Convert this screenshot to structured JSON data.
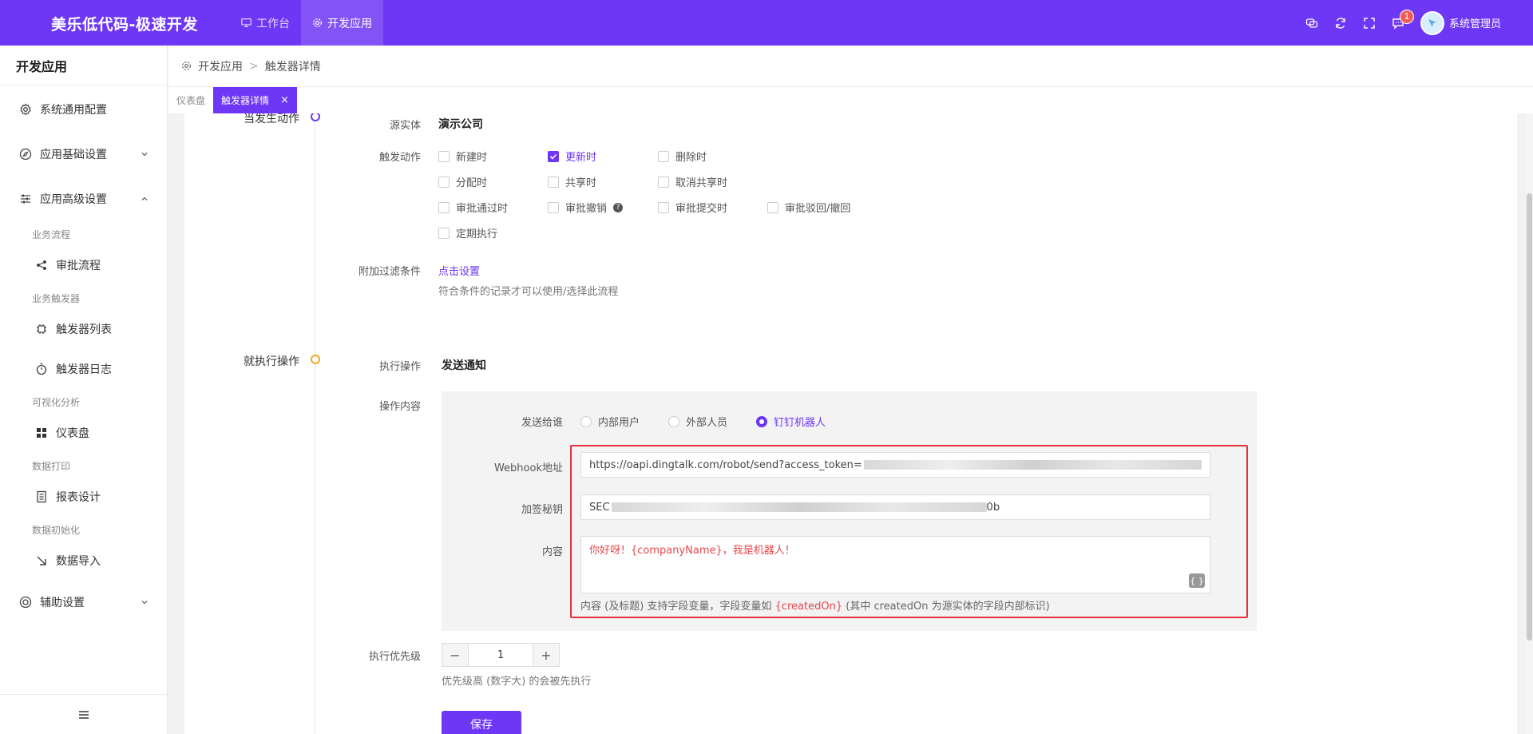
{
  "app": {
    "title": "美乐低代码-极速开发"
  },
  "topnav": {
    "items": [
      {
        "label": "工作台"
      },
      {
        "label": "开发应用"
      }
    ]
  },
  "topright": {
    "notification_count": "1",
    "user_name": "系统管理员"
  },
  "sidebar": {
    "title": "开发应用",
    "items": {
      "system_config": "系统通用配置",
      "app_basic": "应用基础设置",
      "app_advanced": "应用高级设置",
      "group_flow": "业务流程",
      "approval_flow": "审批流程",
      "group_trigger": "业务触发器",
      "trigger_list": "触发器列表",
      "trigger_log": "触发器日志",
      "group_visual": "可视化分析",
      "dashboard": "仪表盘",
      "group_print": "数据打印",
      "report_design": "报表设计",
      "group_init": "数据初始化",
      "data_import": "数据导入",
      "aux_settings": "辅助设置"
    }
  },
  "breadcrumb": {
    "parent": "开发应用",
    "separator": ">",
    "current": "触发器详情"
  },
  "tabs": {
    "dashboard": "仪表盘",
    "active": "触发器详情",
    "close": "×"
  },
  "steps": {
    "when": "当发生动作",
    "then": "就执行操作"
  },
  "form": {
    "source_entity_label": "源实体",
    "source_entity_value": "演示公司",
    "trigger_action_label": "触发动作",
    "actions": [
      {
        "label": "新建时",
        "checked": false
      },
      {
        "label": "更新时",
        "checked": true
      },
      {
        "label": "删除时",
        "checked": false
      },
      {
        "label": "分配时",
        "checked": false
      },
      {
        "label": "共享时",
        "checked": false
      },
      {
        "label": "取消共享时",
        "checked": false
      },
      {
        "label": "审批通过时",
        "checked": false
      },
      {
        "label": "审批撤销",
        "checked": false
      },
      {
        "label": "审批提交时",
        "checked": false
      },
      {
        "label": "审批驳回/撤回",
        "checked": false
      },
      {
        "label": "定期执行",
        "checked": false
      }
    ],
    "filter_label": "附加过滤条件",
    "filter_link": "点击设置",
    "filter_hint": "符合条件的记录才可以使用/选择此流程",
    "exec_op_label": "执行操作",
    "exec_op_value": "发送通知",
    "op_content_label": "操作内容",
    "send_to_label": "发送给谁",
    "send_to_options": [
      {
        "label": "内部用户",
        "selected": false
      },
      {
        "label": "外部人员",
        "selected": false
      },
      {
        "label": "钉钉机器人",
        "selected": true
      }
    ],
    "webhook_label": "Webhook地址",
    "webhook_value": "https://oapi.dingtalk.com/robot/send?access_token=",
    "secret_label": "加签秘钥",
    "secret_prefix": "SEC",
    "secret_suffix": "0b",
    "content_label": "内容",
    "content_value": "你好呀！{companyName}，我是机器人！",
    "brace_label": "{ }",
    "content_help_prefix": "内容 (及标题) 支持字段变量，字段变量如",
    "content_help_var": "{createdOn}",
    "content_help_suffix": "(其中 createdOn 为源实体的字段内部标识)",
    "priority_label": "执行优先级",
    "priority_value": "1",
    "priority_hint": "优先级高 (数字大) 的会被先执行",
    "save_label": "保存"
  },
  "colors": {
    "brand": "#6e36f5",
    "highlight_border": "#e5323a",
    "variable": "#e5484d"
  }
}
